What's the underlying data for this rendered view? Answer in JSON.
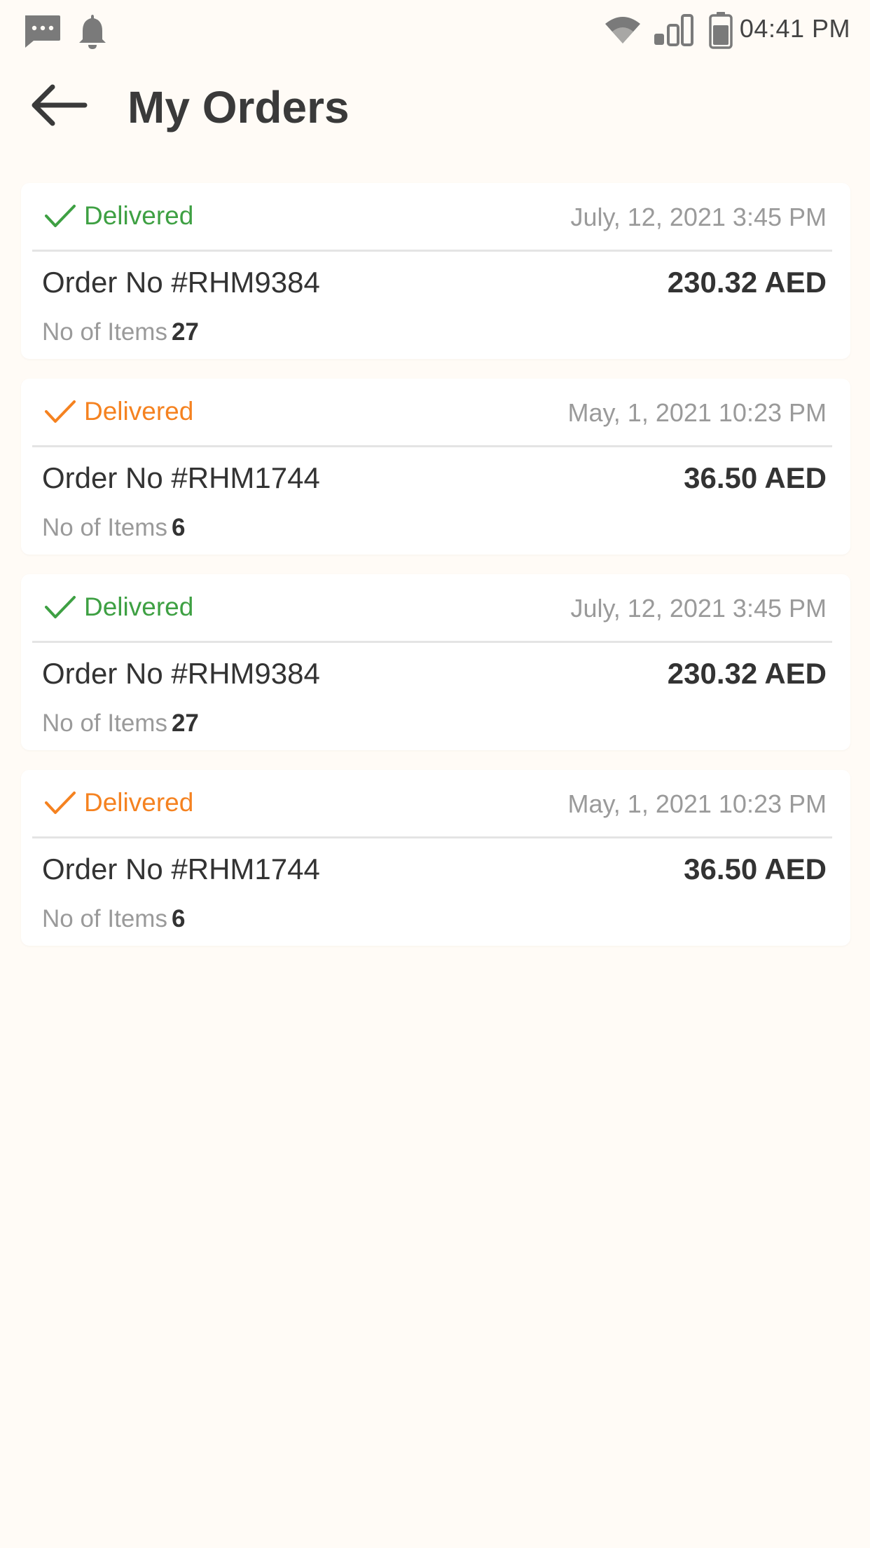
{
  "status_bar": {
    "time": "04:41 PM",
    "icons": [
      "message-icon",
      "bell-icon",
      "wifi-icon",
      "signal-icon",
      "battery-icon"
    ]
  },
  "header": {
    "back_icon": "arrow-left-icon",
    "title": "My Orders"
  },
  "colors": {
    "green": "#3ea043",
    "orange": "#f58220",
    "background": "#fffbf6"
  },
  "orders": [
    {
      "status": "Delivered",
      "status_color": "#3ea043",
      "date": "July, 12, 2021 3:45 PM",
      "order_no": "Order No #RHM9384",
      "amount": "230.32 AED",
      "items_label": "No of Items",
      "items_count": "27"
    },
    {
      "status": "Delivered",
      "status_color": "#f58220",
      "date": "May, 1, 2021 10:23 PM",
      "order_no": "Order No #RHM1744",
      "amount": "36.50 AED",
      "items_label": "No of Items",
      "items_count": "6"
    },
    {
      "status": "Delivered",
      "status_color": "#3ea043",
      "date": "July, 12, 2021 3:45 PM",
      "order_no": "Order No #RHM9384",
      "amount": "230.32 AED",
      "items_label": "No of Items",
      "items_count": "27"
    },
    {
      "status": "Delivered",
      "status_color": "#f58220",
      "date": "May, 1, 2021 10:23 PM",
      "order_no": "Order No #RHM1744",
      "amount": "36.50 AED",
      "items_label": "No of Items",
      "items_count": "6"
    }
  ]
}
